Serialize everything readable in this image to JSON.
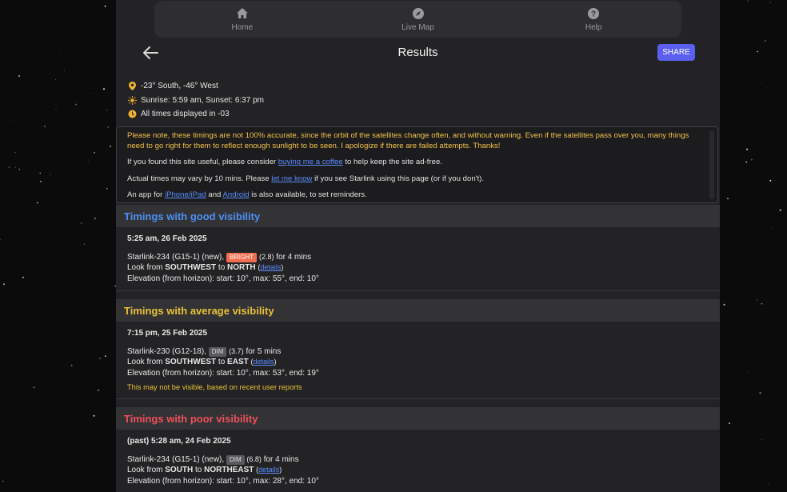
{
  "nav": {
    "items": [
      {
        "label": "Home",
        "icon": "home-icon"
      },
      {
        "label": "Live Map",
        "icon": "compass-icon"
      },
      {
        "label": "Help",
        "icon": "help-icon"
      }
    ]
  },
  "header": {
    "title": "Results",
    "share_label": "SHARE"
  },
  "info": {
    "location": "-23° South, -46° West",
    "sun": "Sunrise: 5:59 am, Sunset: 6:37 pm",
    "timezone": "All times displayed in -03"
  },
  "notice": {
    "warning": "Please note, these timings are not 100% accurate, since the orbit of the satellites change often, and without warning. Even if the satellites pass over you, many things need to go right for them to reflect enough sunlight to be seen. I apologize if there are failed attempts. Thanks!",
    "coffee_pre": "If you found this site useful, please consider ",
    "coffee_link": "buying me a coffee",
    "coffee_post": " to help keep the site ad-free.",
    "vary_pre": "Actual times may vary by 10 mins. Please ",
    "vary_link": "let me know",
    "vary_post": " if you see Starlink using this page (or if you don't).",
    "app_pre": "An app for ",
    "app_link1": "iPhone/iPad",
    "app_mid": " and ",
    "app_link2": "Android",
    "app_post": " is also available, to set reminders."
  },
  "sections": {
    "good": {
      "title": "Timings with good visibility",
      "pass": {
        "when": "5:25 am, 26 Feb 2025",
        "sat": "Starlink-234 (G15-1) (new),",
        "badge": "BRIGHT",
        "mag": "(2.8)",
        "duration": "for 4 mins",
        "look_pre": "Look from ",
        "from": "SOUTHWEST",
        "to_word": " to ",
        "to": "NORTH",
        "details": "details",
        "elevation": "Elevation (from horizon): start: 10°, max: 55°, end: 10°"
      }
    },
    "average": {
      "title": "Timings with average visibility",
      "pass": {
        "when": "7:15 pm, 25 Feb 2025",
        "sat": "Starlink-230 (G12-18),",
        "badge": "DIM",
        "mag": "(3.7)",
        "duration": "for 5 mins",
        "look_pre": "Look from ",
        "from": "SOUTHWEST",
        "to_word": " to ",
        "to": "EAST",
        "details": "details",
        "elevation": "Elevation (from horizon): start: 10°, max: 53°, end: 19°",
        "note": "This may not be visible, based on recent user reports"
      }
    },
    "poor": {
      "title": "Timings with poor visibility",
      "pass": {
        "when": "(past) 5:28 am, 24 Feb 2025",
        "sat": "Starlink-234 (G15-1) (new),",
        "badge": "DIM",
        "mag": "(6.8)",
        "duration": "for 4 mins",
        "look_pre": "Look from ",
        "from": "SOUTH",
        "to_word": " to ",
        "to": "NORTHEAST",
        "details": "details",
        "elevation": "Elevation (from horizon): start: 10°, max: 28°, end: 10°"
      }
    }
  },
  "colors": {
    "accent": "#5b5ff0",
    "good": "#4d8ef5",
    "average": "#e9c13a",
    "poor": "#ef4f5b",
    "bright_badge": "#f26d4f"
  }
}
